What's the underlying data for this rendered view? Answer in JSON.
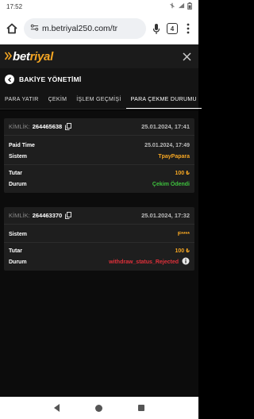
{
  "status": {
    "time": "17:52"
  },
  "browser": {
    "url": "m.betriyal250.com/tr",
    "tab_count": "4"
  },
  "app": {
    "logo_prefix": "bet",
    "logo_suffix": "riyal"
  },
  "section": {
    "title": "BAKİYE YÖNETİMİ"
  },
  "tabs": [
    {
      "label": "PARA YATIR"
    },
    {
      "label": "ÇEKİM"
    },
    {
      "label": "İŞLEM GEÇMİŞİ"
    },
    {
      "label": "PARA ÇEKME DURUMU"
    }
  ],
  "cards": [
    {
      "kimlik_label": "KİMLİK:",
      "kimlik_value": "264465638",
      "date": "25.01.2024, 17:41",
      "paid_time_label": "Paid Time",
      "paid_time_value": "25.01.2024, 17:49",
      "sistem_label": "Sistem",
      "sistem_value": "TpayPapara",
      "tutar_label": "Tutar",
      "tutar_value": "100 ₺",
      "durum_label": "Durum",
      "durum_value": "Çekim Ödendi"
    },
    {
      "kimlik_label": "KİMLİK:",
      "kimlik_value": "264463370",
      "date": "25.01.2024, 17:32",
      "sistem_label": "Sistem",
      "sistem_value": "F****",
      "tutar_label": "Tutar",
      "tutar_value": "100 ₺",
      "durum_label": "Durum",
      "durum_value": "withdraw_status_Rejected"
    }
  ],
  "colors": {
    "accent": "#f5a623",
    "success": "#3ec13e",
    "rejected": "#e0303a"
  }
}
